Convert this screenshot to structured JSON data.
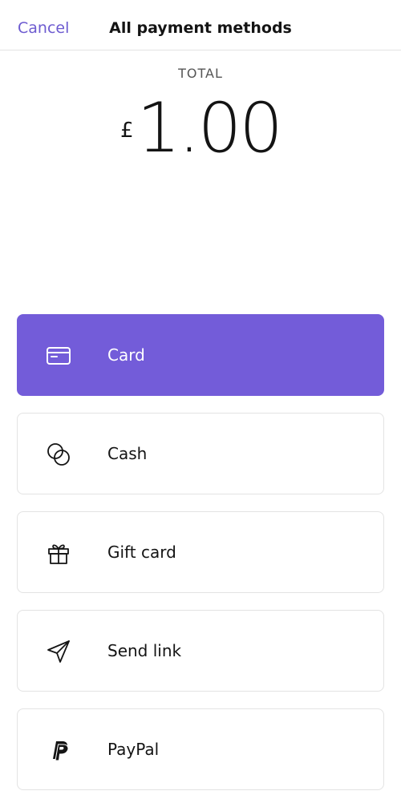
{
  "header": {
    "cancel_label": "Cancel",
    "title": "All payment methods"
  },
  "total": {
    "label": "TOTAL",
    "currency_symbol": "£",
    "amount": "1.00"
  },
  "payment_methods": [
    {
      "label": "Card",
      "icon": "credit-card-icon",
      "selected": true
    },
    {
      "label": "Cash",
      "icon": "coins-icon",
      "selected": false
    },
    {
      "label": "Gift card",
      "icon": "gift-icon",
      "selected": false
    },
    {
      "label": "Send link",
      "icon": "paper-plane-icon",
      "selected": false
    },
    {
      "label": "PayPal",
      "icon": "paypal-icon",
      "selected": false
    }
  ],
  "colors": {
    "accent": "#735cd9",
    "cancel_text": "#6d5bd0",
    "border": "#e3e3e3"
  }
}
